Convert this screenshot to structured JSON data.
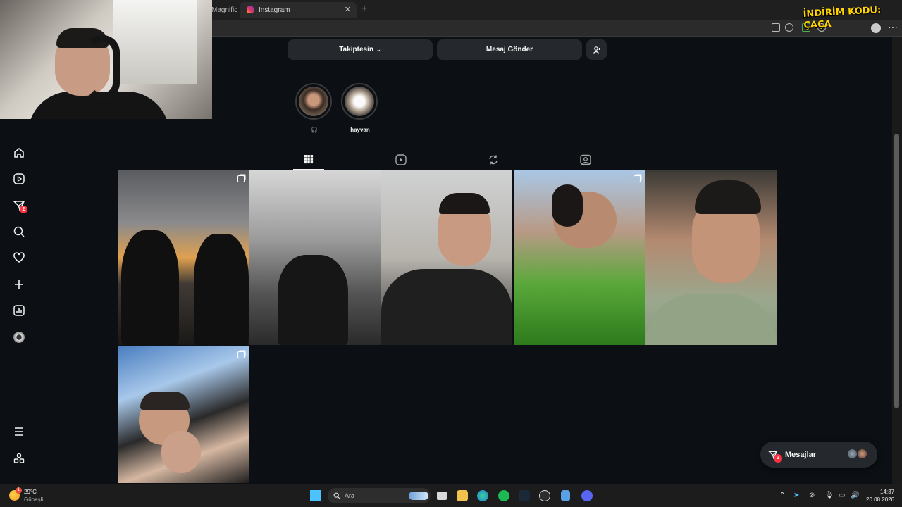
{
  "browser": {
    "tabs": [
      {
        "title": "Magnific"
      },
      {
        "title": "Instagram"
      }
    ],
    "new_tab_symbol": "+",
    "promo_text": "İNDİRİM KODU: ÇAÇA",
    "more_symbol": "···"
  },
  "profile": {
    "follow_button": "Takiptesin",
    "message_button": "Mesaj Gönder",
    "highlights": [
      {
        "label": "🎧"
      },
      {
        "label": "hayvan"
      }
    ],
    "content_tabs": [
      "posts-grid-icon",
      "reels-icon",
      "reposts-icon",
      "tagged-icon"
    ],
    "posts_count": 6
  },
  "nav": {
    "items": [
      "home-icon",
      "reels-icon",
      "messages-icon",
      "search-icon",
      "notifications-icon",
      "create-icon",
      "dashboard-icon",
      "profile-avatar",
      "menu-icon",
      "apps-icon"
    ],
    "messages_badge": "2"
  },
  "messages_pill": {
    "label": "Mesajlar",
    "badge": "2"
  },
  "taskbar": {
    "weather": {
      "temp": "29°C",
      "desc": "Güneşli",
      "badge": "1"
    },
    "search_label": "Ara",
    "time": "14:37",
    "date": "20.08.2026"
  },
  "colors": {
    "background": "#0c1014",
    "button": "#25292e",
    "badge": "#ff3040",
    "promo": "#ffd400"
  }
}
